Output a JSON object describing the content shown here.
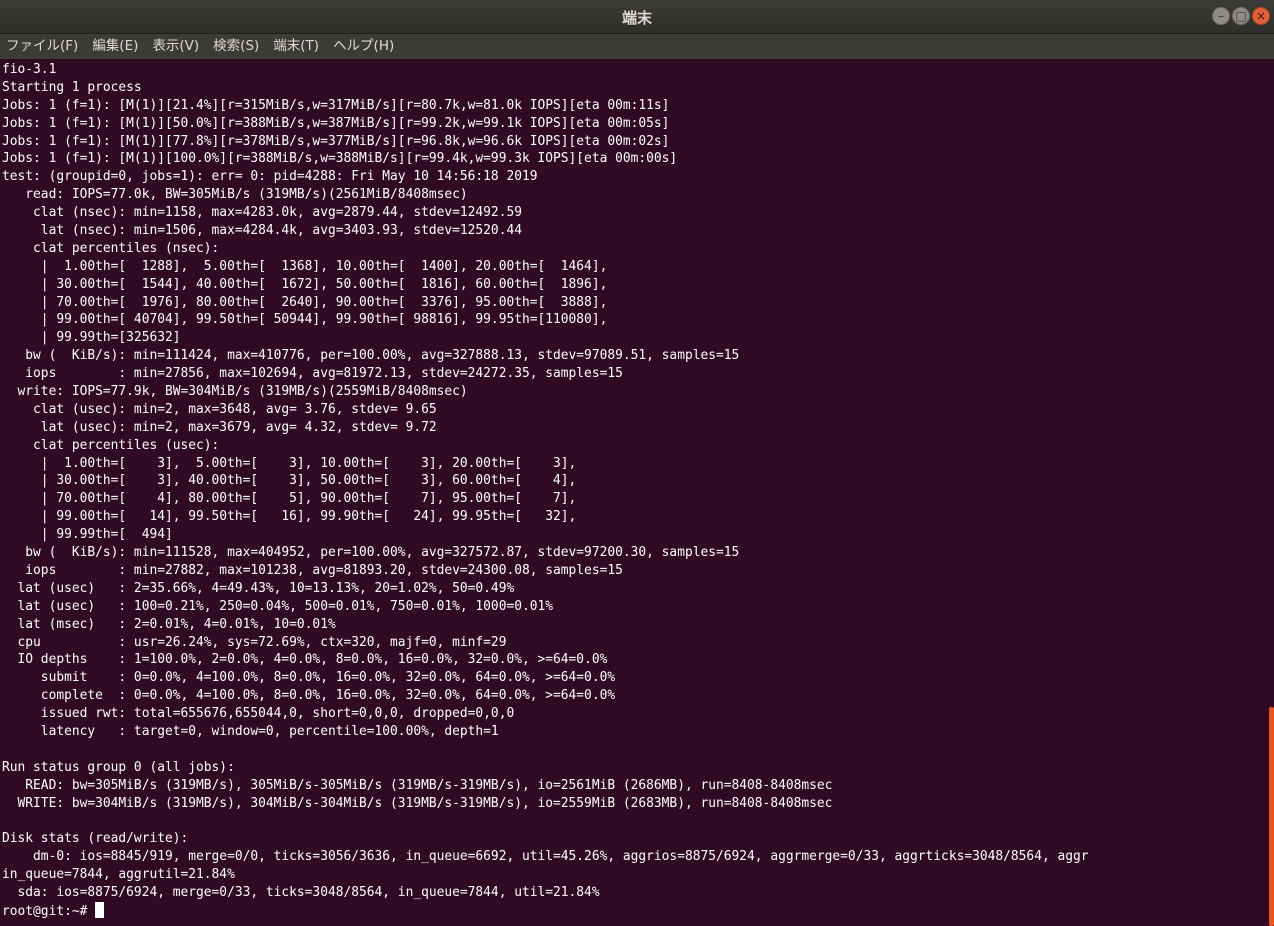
{
  "window": {
    "title": "端末"
  },
  "menubar": {
    "items": [
      "ファイル(F)",
      "編集(E)",
      "表示(V)",
      "検索(S)",
      "端末(T)",
      "ヘルプ(H)"
    ]
  },
  "terminal": {
    "lines": [
      "fio-3.1",
      "Starting 1 process",
      "Jobs: 1 (f=1): [M(1)][21.4%][r=315MiB/s,w=317MiB/s][r=80.7k,w=81.0k IOPS][eta 00m:11s]",
      "Jobs: 1 (f=1): [M(1)][50.0%][r=388MiB/s,w=387MiB/s][r=99.2k,w=99.1k IOPS][eta 00m:05s]",
      "Jobs: 1 (f=1): [M(1)][77.8%][r=378MiB/s,w=377MiB/s][r=96.8k,w=96.6k IOPS][eta 00m:02s]",
      "Jobs: 1 (f=1): [M(1)][100.0%][r=388MiB/s,w=388MiB/s][r=99.4k,w=99.3k IOPS][eta 00m:00s]",
      "test: (groupid=0, jobs=1): err= 0: pid=4288: Fri May 10 14:56:18 2019",
      "   read: IOPS=77.0k, BW=305MiB/s (319MB/s)(2561MiB/8408msec)",
      "    clat (nsec): min=1158, max=4283.0k, avg=2879.44, stdev=12492.59",
      "     lat (nsec): min=1506, max=4284.4k, avg=3403.93, stdev=12520.44",
      "    clat percentiles (nsec):",
      "     |  1.00th=[  1288],  5.00th=[  1368], 10.00th=[  1400], 20.00th=[  1464],",
      "     | 30.00th=[  1544], 40.00th=[  1672], 50.00th=[  1816], 60.00th=[  1896],",
      "     | 70.00th=[  1976], 80.00th=[  2640], 90.00th=[  3376], 95.00th=[  3888],",
      "     | 99.00th=[ 40704], 99.50th=[ 50944], 99.90th=[ 98816], 99.95th=[110080],",
      "     | 99.99th=[325632]",
      "   bw (  KiB/s): min=111424, max=410776, per=100.00%, avg=327888.13, stdev=97089.51, samples=15",
      "   iops        : min=27856, max=102694, avg=81972.13, stdev=24272.35, samples=15",
      "  write: IOPS=77.9k, BW=304MiB/s (319MB/s)(2559MiB/8408msec)",
      "    clat (usec): min=2, max=3648, avg= 3.76, stdev= 9.65",
      "     lat (usec): min=2, max=3679, avg= 4.32, stdev= 9.72",
      "    clat percentiles (usec):",
      "     |  1.00th=[    3],  5.00th=[    3], 10.00th=[    3], 20.00th=[    3],",
      "     | 30.00th=[    3], 40.00th=[    3], 50.00th=[    3], 60.00th=[    4],",
      "     | 70.00th=[    4], 80.00th=[    5], 90.00th=[    7], 95.00th=[    7],",
      "     | 99.00th=[   14], 99.50th=[   16], 99.90th=[   24], 99.95th=[   32],",
      "     | 99.99th=[  494]",
      "   bw (  KiB/s): min=111528, max=404952, per=100.00%, avg=327572.87, stdev=97200.30, samples=15",
      "   iops        : min=27882, max=101238, avg=81893.20, stdev=24300.08, samples=15",
      "  lat (usec)   : 2=35.66%, 4=49.43%, 10=13.13%, 20=1.02%, 50=0.49%",
      "  lat (usec)   : 100=0.21%, 250=0.04%, 500=0.01%, 750=0.01%, 1000=0.01%",
      "  lat (msec)   : 2=0.01%, 4=0.01%, 10=0.01%",
      "  cpu          : usr=26.24%, sys=72.69%, ctx=320, majf=0, minf=29",
      "  IO depths    : 1=100.0%, 2=0.0%, 4=0.0%, 8=0.0%, 16=0.0%, 32=0.0%, >=64=0.0%",
      "     submit    : 0=0.0%, 4=100.0%, 8=0.0%, 16=0.0%, 32=0.0%, 64=0.0%, >=64=0.0%",
      "     complete  : 0=0.0%, 4=100.0%, 8=0.0%, 16=0.0%, 32=0.0%, 64=0.0%, >=64=0.0%",
      "     issued rwt: total=655676,655044,0, short=0,0,0, dropped=0,0,0",
      "     latency   : target=0, window=0, percentile=100.00%, depth=1",
      "",
      "Run status group 0 (all jobs):",
      "   READ: bw=305MiB/s (319MB/s), 305MiB/s-305MiB/s (319MB/s-319MB/s), io=2561MiB (2686MB), run=8408-8408msec",
      "  WRITE: bw=304MiB/s (319MB/s), 304MiB/s-304MiB/s (319MB/s-319MB/s), io=2559MiB (2683MB), run=8408-8408msec",
      "",
      "Disk stats (read/write):",
      "    dm-0: ios=8845/919, merge=0/0, ticks=3056/3636, in_queue=6692, util=45.26%, aggrios=8875/6924, aggrmerge=0/33, aggrticks=3048/8564, aggr",
      "in_queue=7844, aggrutil=21.84%",
      "  sda: ios=8875/6924, merge=0/33, ticks=3048/8564, in_queue=7844, util=21.84%"
    ],
    "prompt": "root@git:~# "
  },
  "colors": {
    "background": "#300a24",
    "foreground": "#ffffff",
    "scrollbar": "#e95420",
    "titlebar": "#3c3b37"
  },
  "icons": {
    "minimize": "minimize-icon",
    "maximize": "maximize-icon",
    "close": "close-icon"
  }
}
